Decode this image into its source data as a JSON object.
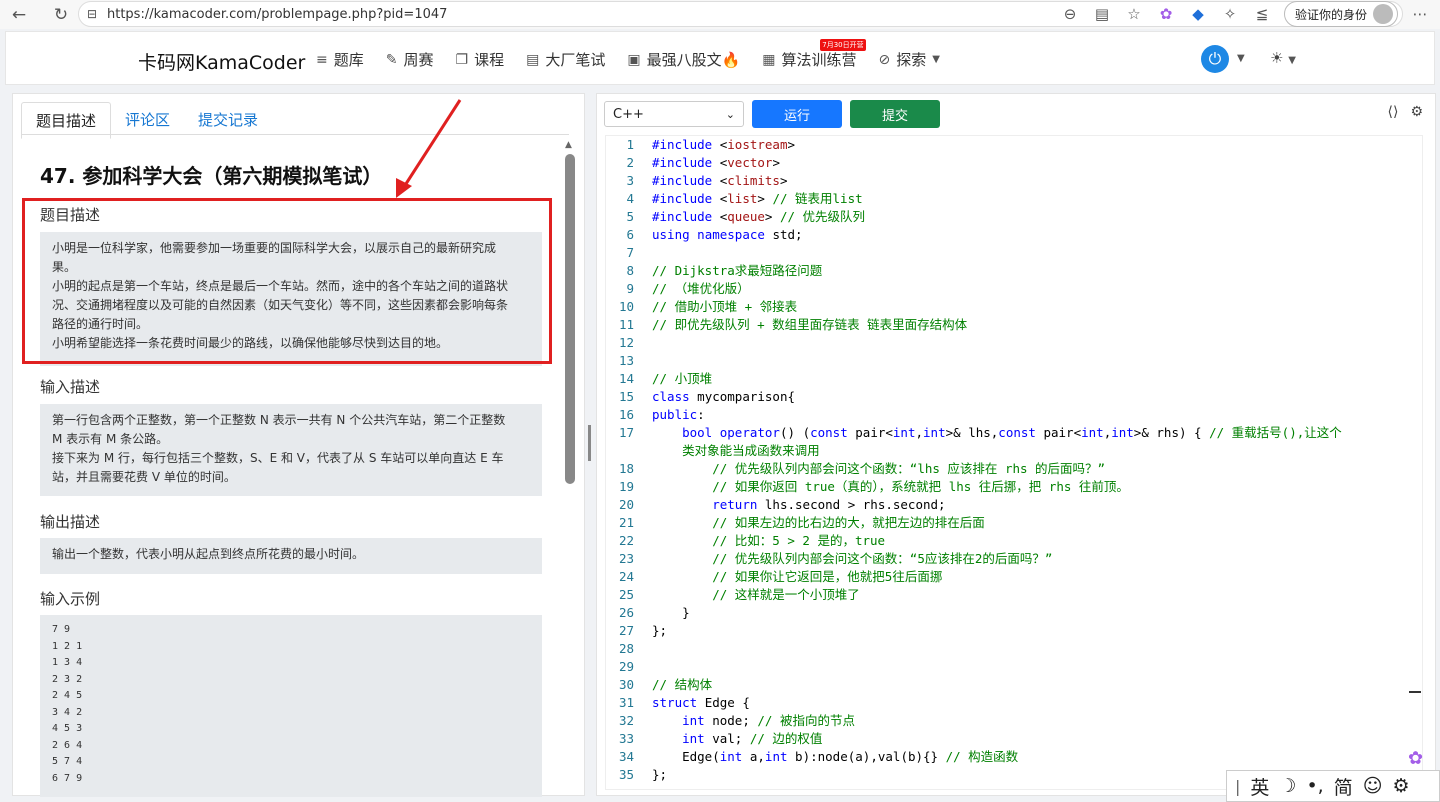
{
  "browser": {
    "url": "https://kamacoder.com/problempage.php?pid=1047",
    "profile_label": "验证你的身份"
  },
  "header": {
    "brand": "卡码网KamaCoder",
    "menu": [
      {
        "label": "题库",
        "icon": "list-icon"
      },
      {
        "label": "周赛",
        "icon": "pencil-icon"
      },
      {
        "label": "课程",
        "icon": "copy-icon"
      },
      {
        "label": "大厂笔试",
        "icon": "document-icon"
      },
      {
        "label": "最强八股文🔥",
        "icon": "book-icon"
      },
      {
        "label": "算法训练营",
        "icon": "calendar-icon",
        "badge": "7月30日开营"
      },
      {
        "label": "探索",
        "icon": "compass-icon"
      }
    ]
  },
  "tabs": [
    "题目描述",
    "评论区",
    "提交记录"
  ],
  "problem": {
    "title": "47. 参加科学大会（第六期模拟笔试）",
    "desc_title": "题目描述",
    "desc_lines": [
      "小明是一位科学家，他需要参加一场重要的国际科学大会，以展示自己的最新研究成",
      "果。",
      "小明的起点是第一个车站，终点是最后一个车站。然而，途中的各个车站之间的道路状",
      "况、交通拥堵程度以及可能的自然因素（如天气变化）等不同，这些因素都会影响每条",
      "路径的通行时间。",
      "小明希望能选择一条花费时间最少的路线，以确保他能够尽快到达目的地。"
    ],
    "input_title": "输入描述",
    "input_lines": [
      "第一行包含两个正整数，第一个正整数 N 表示一共有 N 个公共汽车站，第二个正整数",
      "M 表示有 M 条公路。",
      "接下来为 M 行，每行包括三个整数，S、E 和 V，代表了从 S 车站可以单向直达 E 车",
      "站，并且需要花费 V 单位的时间。"
    ],
    "output_title": "输出描述",
    "output_lines": [
      "输出一个整数，代表小明从起点到终点所花费的最小时间。"
    ],
    "example_title": "输入示例",
    "example_lines": [
      "7 9",
      "1 2 1",
      "1 3 4",
      "2 3 2",
      "2 4 5",
      "3 4 2",
      "4 5 3",
      "2 6 4",
      "5 7 4",
      "6 7 9"
    ]
  },
  "editor": {
    "language": "C++",
    "run_label": "运行",
    "submit_label": "提交",
    "lines": [
      {
        "n": "1",
        "t": "#include <iostream>"
      },
      {
        "n": "2",
        "t": "#include <vector>"
      },
      {
        "n": "3",
        "t": "#include <climits>"
      },
      {
        "n": "4",
        "t": "#include <list> // 链表用list"
      },
      {
        "n": "5",
        "t": "#include <queue> // 优先级队列"
      },
      {
        "n": "6",
        "t": "using namespace std;"
      },
      {
        "n": "7",
        "t": ""
      },
      {
        "n": "8",
        "t": "// Dijkstra求最短路径问题"
      },
      {
        "n": "9",
        "t": "// （堆优化版）"
      },
      {
        "n": "10",
        "t": "// 借助小顶堆 + 邻接表"
      },
      {
        "n": "11",
        "t": "// 即优先级队列 + 数组里面存链表 链表里面存结构体"
      },
      {
        "n": "12",
        "t": ""
      },
      {
        "n": "13",
        "t": ""
      },
      {
        "n": "14",
        "t": "// 小顶堆"
      },
      {
        "n": "15",
        "t": "class mycomparison{"
      },
      {
        "n": "16",
        "t": "public:"
      },
      {
        "n": "17",
        "t": "    bool operator() (const pair<int,int>& lhs,const pair<int,int>& rhs) { // 重载括号(),让这个"
      },
      {
        "n": "",
        "t": "    类对象能当成函数来调用"
      },
      {
        "n": "18",
        "t": "        // 优先级队列内部会问这个函数：“lhs 应该排在 rhs 的后面吗？”"
      },
      {
        "n": "19",
        "t": "        // 如果你返回 true（真的），系统就把 lhs 往后挪，把 rhs 往前顶。"
      },
      {
        "n": "20",
        "t": "        return lhs.second > rhs.second;"
      },
      {
        "n": "21",
        "t": "        // 如果左边的比右边的大，就把左边的排在后面"
      },
      {
        "n": "22",
        "t": "        // 比如：5 > 2 是的，true"
      },
      {
        "n": "23",
        "t": "        // 优先级队列内部会问这个函数：“5应该排在2的后面吗？”"
      },
      {
        "n": "24",
        "t": "        // 如果你让它返回是，他就把5往后面挪"
      },
      {
        "n": "25",
        "t": "        // 这样就是一个小顶堆了"
      },
      {
        "n": "26",
        "t": "    }"
      },
      {
        "n": "27",
        "t": "};"
      },
      {
        "n": "28",
        "t": ""
      },
      {
        "n": "29",
        "t": ""
      },
      {
        "n": "30",
        "t": "// 结构体"
      },
      {
        "n": "31",
        "t": "struct Edge {"
      },
      {
        "n": "32",
        "t": "    int node; // 被指向的节点"
      },
      {
        "n": "33",
        "t": "    int val; // 边的权值"
      },
      {
        "n": "34",
        "t": "    Edge(int a,int b):node(a),val(b){} // 构造函数"
      },
      {
        "n": "35",
        "t": "};"
      }
    ]
  },
  "ime": [
    "英",
    "简"
  ],
  "colors": {
    "accent": "#1677ff",
    "submit": "#1a8a4a",
    "highlight": "#e02020"
  }
}
